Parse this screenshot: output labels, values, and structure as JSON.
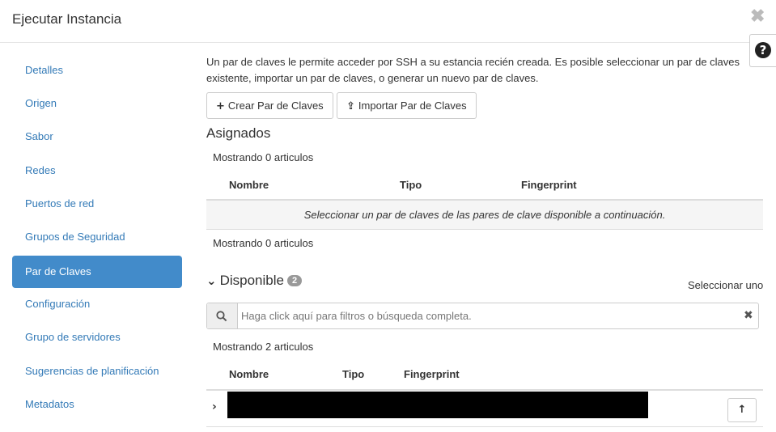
{
  "modal": {
    "title": "Ejecutar Instancia",
    "close_glyph": "✖",
    "help_glyph": "?"
  },
  "nav": {
    "items": [
      {
        "label": "Detalles"
      },
      {
        "label": "Origen"
      },
      {
        "label": "Sabor"
      },
      {
        "label": "Redes"
      },
      {
        "label": "Puertos de red"
      },
      {
        "label": "Grupos de Seguridad"
      },
      {
        "label": "Par de Claves",
        "active": true
      },
      {
        "label": "Configuración"
      },
      {
        "label": "Grupo de servidores"
      },
      {
        "label": "Sugerencias de planificación"
      },
      {
        "label": "Metadatos"
      }
    ]
  },
  "keypair": {
    "intro": "Un par de claves le permite acceder por SSH a su estancia recién creada. Es posible seleccionar un par de claves existente, importar un par de claves, o generar un nuevo par de claves.",
    "create_button": "Crear Par de Claves",
    "import_button": "Importar Par de Claves",
    "create_icon": "plus-icon",
    "import_icon": "upload-icon"
  },
  "assigned": {
    "heading": "Asignados",
    "count_top": "Mostrando 0 articulos",
    "count_bottom": "Mostrando 0 articulos",
    "columns": [
      "Nombre",
      "Tipo",
      "Fingerprint"
    ],
    "empty_message": "Seleccionar un par de claves de las pares de clave disponible a continuación."
  },
  "available": {
    "heading": "Disponible",
    "badge": "2",
    "select_one": "Seleccionar uno",
    "search_placeholder": "Haga click aquí para filtros o búsqueda completa.",
    "count": "Mostrando 2 articulos",
    "columns": [
      "Nombre",
      "Tipo",
      "Fingerprint"
    ]
  },
  "colors": {
    "accent": "#428bca",
    "link": "#337ab7",
    "redacted": "#000000"
  }
}
